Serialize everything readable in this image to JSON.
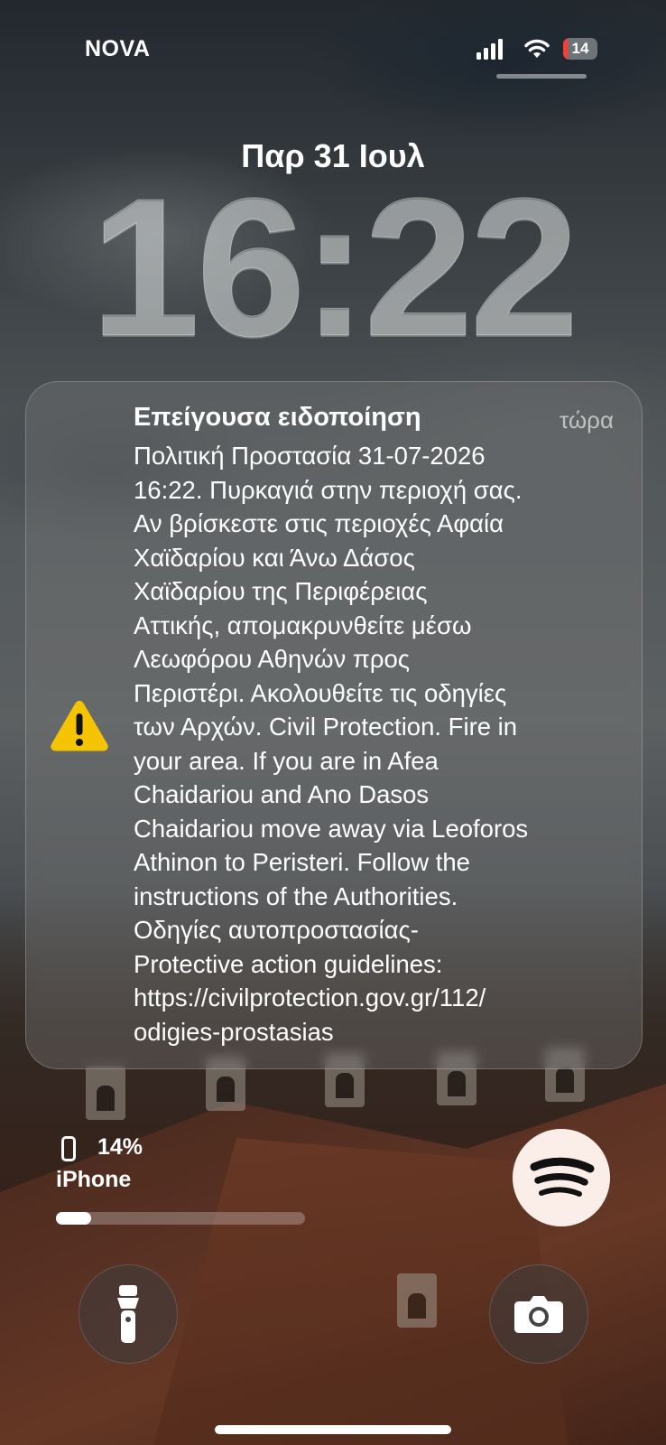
{
  "status_bar": {
    "carrier": "NOVA",
    "battery_percent": "14",
    "battery_level": 0.14,
    "battery_color": "#ff3b30",
    "icons": [
      "cellular-signal-icon",
      "wifi-icon",
      "battery-icon"
    ]
  },
  "lock_screen": {
    "date": "Παρ 31 Ιουλ",
    "time": "16:22"
  },
  "notification": {
    "title": "Επείγουσα ειδοποίηση",
    "time": "τώρα",
    "icon": "warning-icon",
    "icon_color": "#f5c400",
    "body_lines": [
      "Πολιτική Προστασία 31-07-2026",
      "16:22. Πυρκαγιά στην περιοχή σας.",
      "Αν βρίσκεστε στις περιοχές Αφαία",
      "Χαϊδαρίου και Άνω Δάσος",
      "Χαϊδαρίου  της Περιφέρειας",
      "Αττικής, απομακρυνθείτε μέσω",
      "Λεωφόρου Αθηνών προς",
      "Περιστέρι. Ακολουθείτε τις οδηγίες",
      "των Αρχών. Civil Protection. Fire in",
      "your area. If you are in Afea",
      "Chaidariou and Ano Dasos",
      "Chaidariou move away via Leoforos",
      "Athinon to Peristeri. Follow the",
      "instructions of the Authorities.",
      "Οδηγίες αυτοπροστασίας-",
      "Protective action guidelines:",
      "https://civilprotection.gov.gr/112/",
      "odigies-prostasias"
    ]
  },
  "battery_widget": {
    "percent": "14%",
    "device": "iPhone",
    "level": 0.14,
    "icon": "phone-icon"
  },
  "now_playing": {
    "app_icon": "spotify-icon"
  },
  "quick_actions": {
    "left": "flashlight-icon",
    "right": "camera-icon"
  }
}
